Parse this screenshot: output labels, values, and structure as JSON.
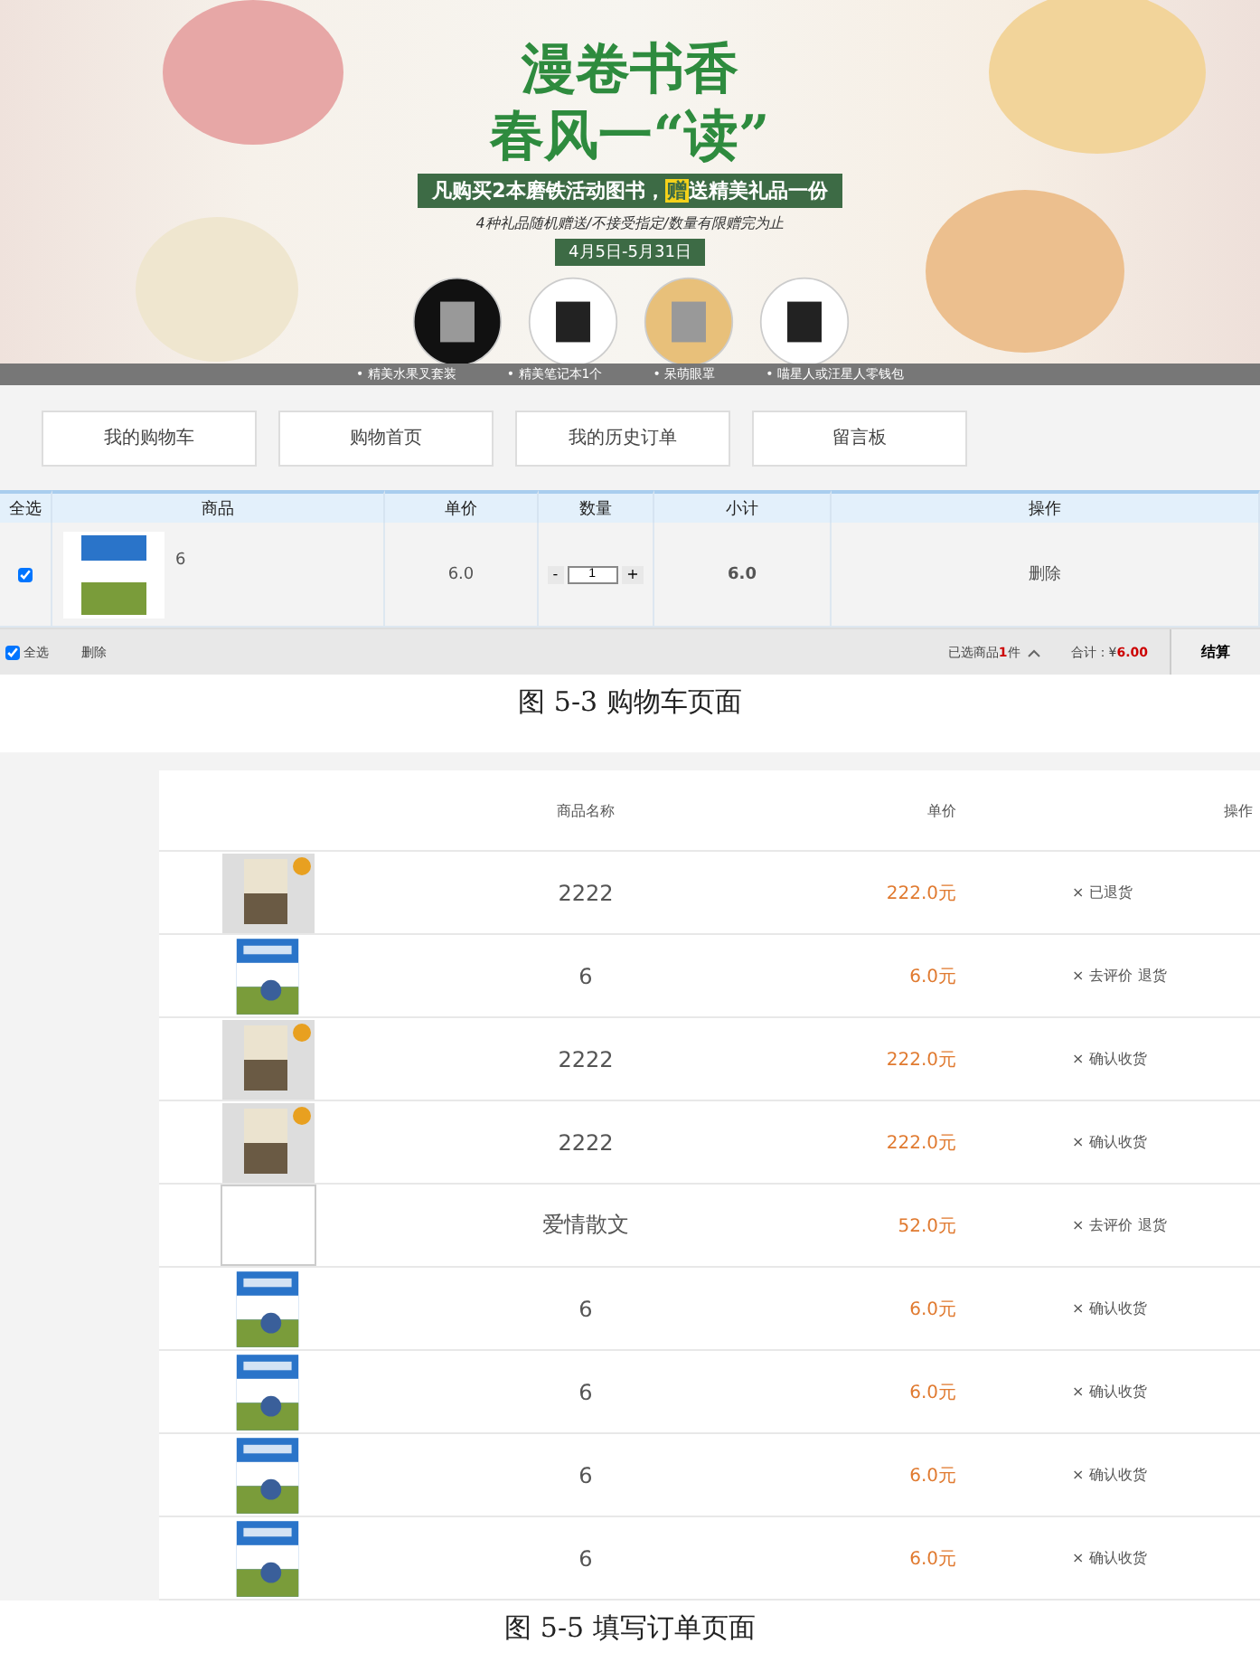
{
  "banner": {
    "title_line_1": "漫卷书香",
    "title_line_2": "春风一“读”",
    "offer": "凡购买2本磨铁活动图书，**赠**送精美礼品一份",
    "rules": "4种礼品随机赠送/不接受指定/数量有限赠完为止",
    "dates": "4月5日-5月31日",
    "gifts": [
      "• 精美水果叉套装",
      "• 精美笔记本1个",
      "• 呆萌眼罩",
      "• 喵星人或汪星人零钱包"
    ]
  },
  "nav": [
    {
      "label": "我的购物车"
    },
    {
      "label": "购物首页"
    },
    {
      "label": "我的历史订单"
    },
    {
      "label": "留言板"
    }
  ],
  "cart": {
    "columns": [
      "全选",
      "商品",
      "单价",
      "数量",
      "小计",
      "操作"
    ],
    "rows": [
      {
        "checked": true,
        "name": "6",
        "price": "6.0",
        "minus": "-",
        "quantity": "1",
        "plus": "+",
        "subtotal": "6.0",
        "action": "删除"
      }
    ],
    "footer": {
      "select_all": "全选",
      "select_all_checked": true,
      "delete": "删除",
      "selected": "已选商品**1**件",
      "total_label": "合计：¥",
      "total": "6.00",
      "checkout": "结算"
    }
  },
  "caption_1": "图 5-3  购物车页面",
  "orders": {
    "columns": [
      "商品名称",
      "单价",
      "操作"
    ],
    "rows": [
      {
        "kind": "gray",
        "name": "2222",
        "price": "222.0元",
        "mark": "×",
        "actions": [
          "已退货"
        ]
      },
      {
        "kind": "blue",
        "name": "6",
        "price": "6.0元",
        "mark": "×",
        "actions": [
          "去评价",
          "退货"
        ]
      },
      {
        "kind": "gray",
        "name": "2222",
        "price": "222.0元",
        "mark": "×",
        "actions": [
          "确认收货"
        ]
      },
      {
        "kind": "gray",
        "name": "2222",
        "price": "222.0元",
        "mark": "×",
        "actions": [
          "确认收货"
        ]
      },
      {
        "kind": "broken",
        "name": "爱情散文",
        "price": "52.0元",
        "mark": "×",
        "actions": [
          "去评价",
          "退货"
        ]
      },
      {
        "kind": "blue",
        "name": "6",
        "price": "6.0元",
        "mark": "×",
        "actions": [
          "确认收货"
        ]
      },
      {
        "kind": "blue",
        "name": "6",
        "price": "6.0元",
        "mark": "×",
        "actions": [
          "确认收货"
        ]
      },
      {
        "kind": "blue",
        "name": "6",
        "price": "6.0元",
        "mark": "×",
        "actions": [
          "确认收货"
        ]
      },
      {
        "kind": "blue",
        "name": "6",
        "price": "6.0元",
        "mark": "×",
        "actions": [
          "确认收货"
        ]
      }
    ]
  },
  "caption_2": "图 5-5  填写订单页面"
}
